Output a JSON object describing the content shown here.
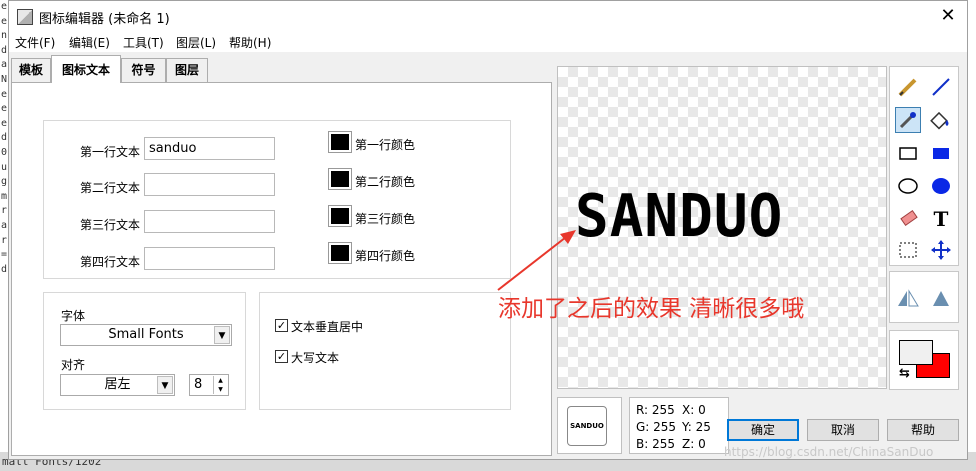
{
  "window": {
    "title": "图标编辑器 (未命名 1)",
    "close": "✕"
  },
  "menu": [
    "文件(F)",
    "编辑(E)",
    "工具(T)",
    "图层(L)",
    "帮助(H)"
  ],
  "tabs": [
    "模板",
    "图标文本",
    "符号",
    "图层"
  ],
  "active_tab": "图标文本",
  "text_lines": [
    {
      "label": "第一行文本",
      "value": "sanduo",
      "color_label": "第一行颜色",
      "color": "#000000"
    },
    {
      "label": "第二行文本",
      "value": "",
      "color_label": "第二行颜色",
      "color": "#000000"
    },
    {
      "label": "第三行文本",
      "value": "",
      "color_label": "第三行颜色",
      "color": "#000000"
    },
    {
      "label": "第四行文本",
      "value": "",
      "color_label": "第四行颜色",
      "color": "#000000"
    }
  ],
  "font": {
    "label": "字体",
    "value": "Small Fonts"
  },
  "align": {
    "label": "对齐",
    "value": "居左",
    "size": "8"
  },
  "options": [
    {
      "label": "文本垂直居中",
      "checked": true
    },
    {
      "label": "大写文本",
      "checked": true
    }
  ],
  "canvas": {
    "rendered_text": "SANDUO"
  },
  "annotation": "添加了之后的效果 清晰很多哦",
  "preview_text": "SANDUO",
  "readout": {
    "r": "R: 255",
    "g": "G: 255",
    "b": "B: 255",
    "x": "X: 0",
    "y": "Y: 25",
    "z": "Z: 0"
  },
  "buttons": {
    "ok": "确定",
    "cancel": "取消",
    "help": "帮助"
  },
  "colors": {
    "foreground": "#f0f0f0",
    "background": "#ff0000",
    "annotation": "#e8372c"
  },
  "watermark": "https://blog.csdn.net/ChinaSanDuo",
  "background_window": {
    "left_chars": [
      "e",
      "e",
      "n",
      "d",
      "a",
      "N",
      "e",
      "e",
      "e",
      "d",
      "0",
      "u",
      "g",
      "m",
      "r",
      "a",
      "r",
      "=",
      "d"
    ],
    "bottom_text": "mall Fonts/1202"
  }
}
